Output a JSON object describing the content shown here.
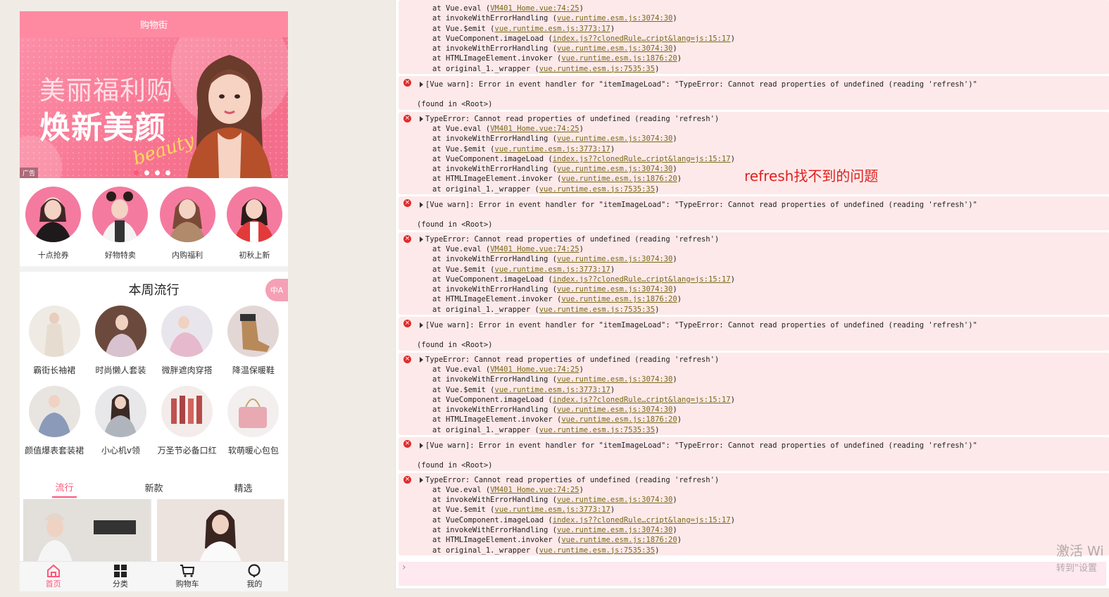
{
  "app": {
    "nav_title": "购物街",
    "banner": {
      "line1": "美丽福利购",
      "line2": "焕新美颜",
      "script": "beauty",
      "ad_label": "广告"
    },
    "recommends": [
      {
        "label": "十点抢券"
      },
      {
        "label": "好物特卖"
      },
      {
        "label": "内购福利"
      },
      {
        "label": "初秋上新"
      }
    ],
    "feature": {
      "title": "本周流行",
      "toggle": "中A",
      "items": [
        {
          "label": "霸街长袖裙"
        },
        {
          "label": "时尚懒人套装"
        },
        {
          "label": "微胖遮肉穿搭"
        },
        {
          "label": "降温保暖鞋"
        },
        {
          "label": "颜值爆表套装裙"
        },
        {
          "label": "小心机v领"
        },
        {
          "label": "万圣节必备口红"
        },
        {
          "label": "软萌暖心包包"
        }
      ]
    },
    "tabs": [
      {
        "label": "流行"
      },
      {
        "label": "新款"
      },
      {
        "label": "精选"
      }
    ],
    "tabbar": [
      {
        "label": "首页"
      },
      {
        "label": "分类"
      },
      {
        "label": "购物车"
      },
      {
        "label": "我的"
      }
    ]
  },
  "console": {
    "stack_top": [
      "at Vue.eval (",
      "at invokeWithErrorHandling (",
      "at Vue.$emit (",
      "at VueComponent.imageLoad (",
      "at invokeWithErrorHandling (",
      "at HTMLImageElement.invoker (",
      "at original_1._wrapper ("
    ],
    "stack_links": [
      "VM401 Home.vue:74:25",
      "vue.runtime.esm.js:3074:30",
      "vue.runtime.esm.js:3773:17",
      "index.js??clonedRule…cript&lang=js:15:17",
      "vue.runtime.esm.js:3074:30",
      "vue.runtime.esm.js:1876:20",
      "vue.runtime.esm.js:7535:35"
    ],
    "warn_text": "[Vue warn]: Error in event handler for \"itemImageLoad\": \"TypeError: Cannot read properties of undefined (reading 'refresh')\"",
    "found_text": "(found in <Root>)",
    "type_error": "TypeError: Cannot read properties of undefined (reading 'refresh')",
    "annotation": "refresh找不到的问题",
    "prompt": "›"
  },
  "watermark": {
    "line1": "激活 Wi",
    "line2": "转到\"设置"
  }
}
